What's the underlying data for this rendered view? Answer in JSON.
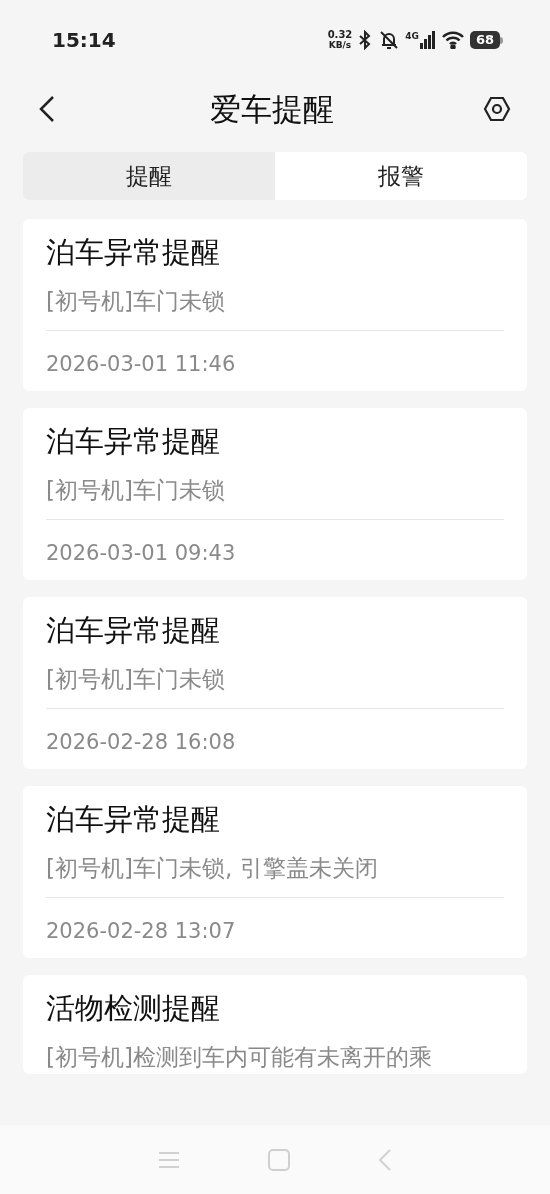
{
  "status_bar": {
    "time": "15:14",
    "speed_value": "0.32",
    "speed_unit": "KB/s",
    "network": "4G",
    "battery": "68"
  },
  "header": {
    "title": "爱车提醒"
  },
  "tabs": [
    {
      "label": "提醒",
      "selected": true
    },
    {
      "label": "报警",
      "selected": false
    }
  ],
  "alerts": [
    {
      "title": "泊车异常提醒",
      "message": "[初号机]车门未锁",
      "time": "2026-03-01 11:46"
    },
    {
      "title": "泊车异常提醒",
      "message": "[初号机]车门未锁",
      "time": "2026-03-01 09:43"
    },
    {
      "title": "泊车异常提醒",
      "message": "[初号机]车门未锁",
      "time": "2026-02-28 16:08"
    },
    {
      "title": "泊车异常提醒",
      "message": "[初号机]车门未锁, 引擎盖未关闭",
      "time": "2026-02-28 13:07"
    },
    {
      "title": "活物检测提醒",
      "message": "[初号机]检测到车内可能有未离开的乘"
    }
  ]
}
